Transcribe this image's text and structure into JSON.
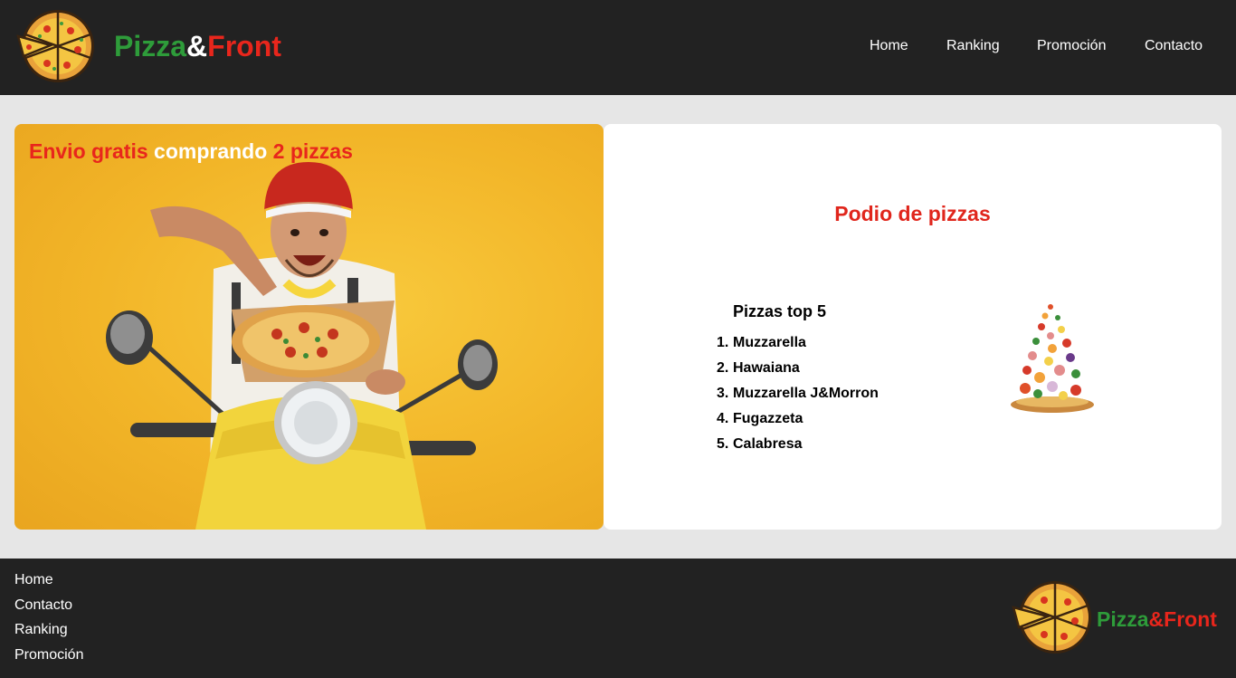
{
  "header": {
    "brand_part1": "Pizza",
    "brand_part2": "&",
    "brand_part3": "Front"
  },
  "nav": {
    "items": [
      {
        "label": "Home"
      },
      {
        "label": "Ranking"
      },
      {
        "label": "Promoción"
      },
      {
        "label": "Contacto"
      }
    ]
  },
  "promo": {
    "title_part1": "Envio gratis",
    "title_part2": "comprando",
    "title_part3": "2 pizzas"
  },
  "podium": {
    "title": "Podio de pizzas",
    "list_title": "Pizzas top 5",
    "items": [
      {
        "num": "1.",
        "name": "Muzzarella"
      },
      {
        "num": "2.",
        "name": "Hawaiana"
      },
      {
        "num": "3.",
        "name": "Muzzarella J&Morron"
      },
      {
        "num": "4.",
        "name": "Fugazzeta"
      },
      {
        "num": "5.",
        "name": "Calabresa"
      }
    ]
  },
  "footer": {
    "links": [
      {
        "label": "Home"
      },
      {
        "label": "Contacto"
      },
      {
        "label": "Ranking"
      },
      {
        "label": "Promoción"
      }
    ],
    "brand_part1": "Pizza",
    "brand_part2": "&Front"
  },
  "colors": {
    "dark_bar": "#222222",
    "brand_green": "#2e9c3a",
    "brand_red": "#e8261c",
    "page_bg": "#e6e6e6",
    "promo_yellow": "#f2b528"
  }
}
